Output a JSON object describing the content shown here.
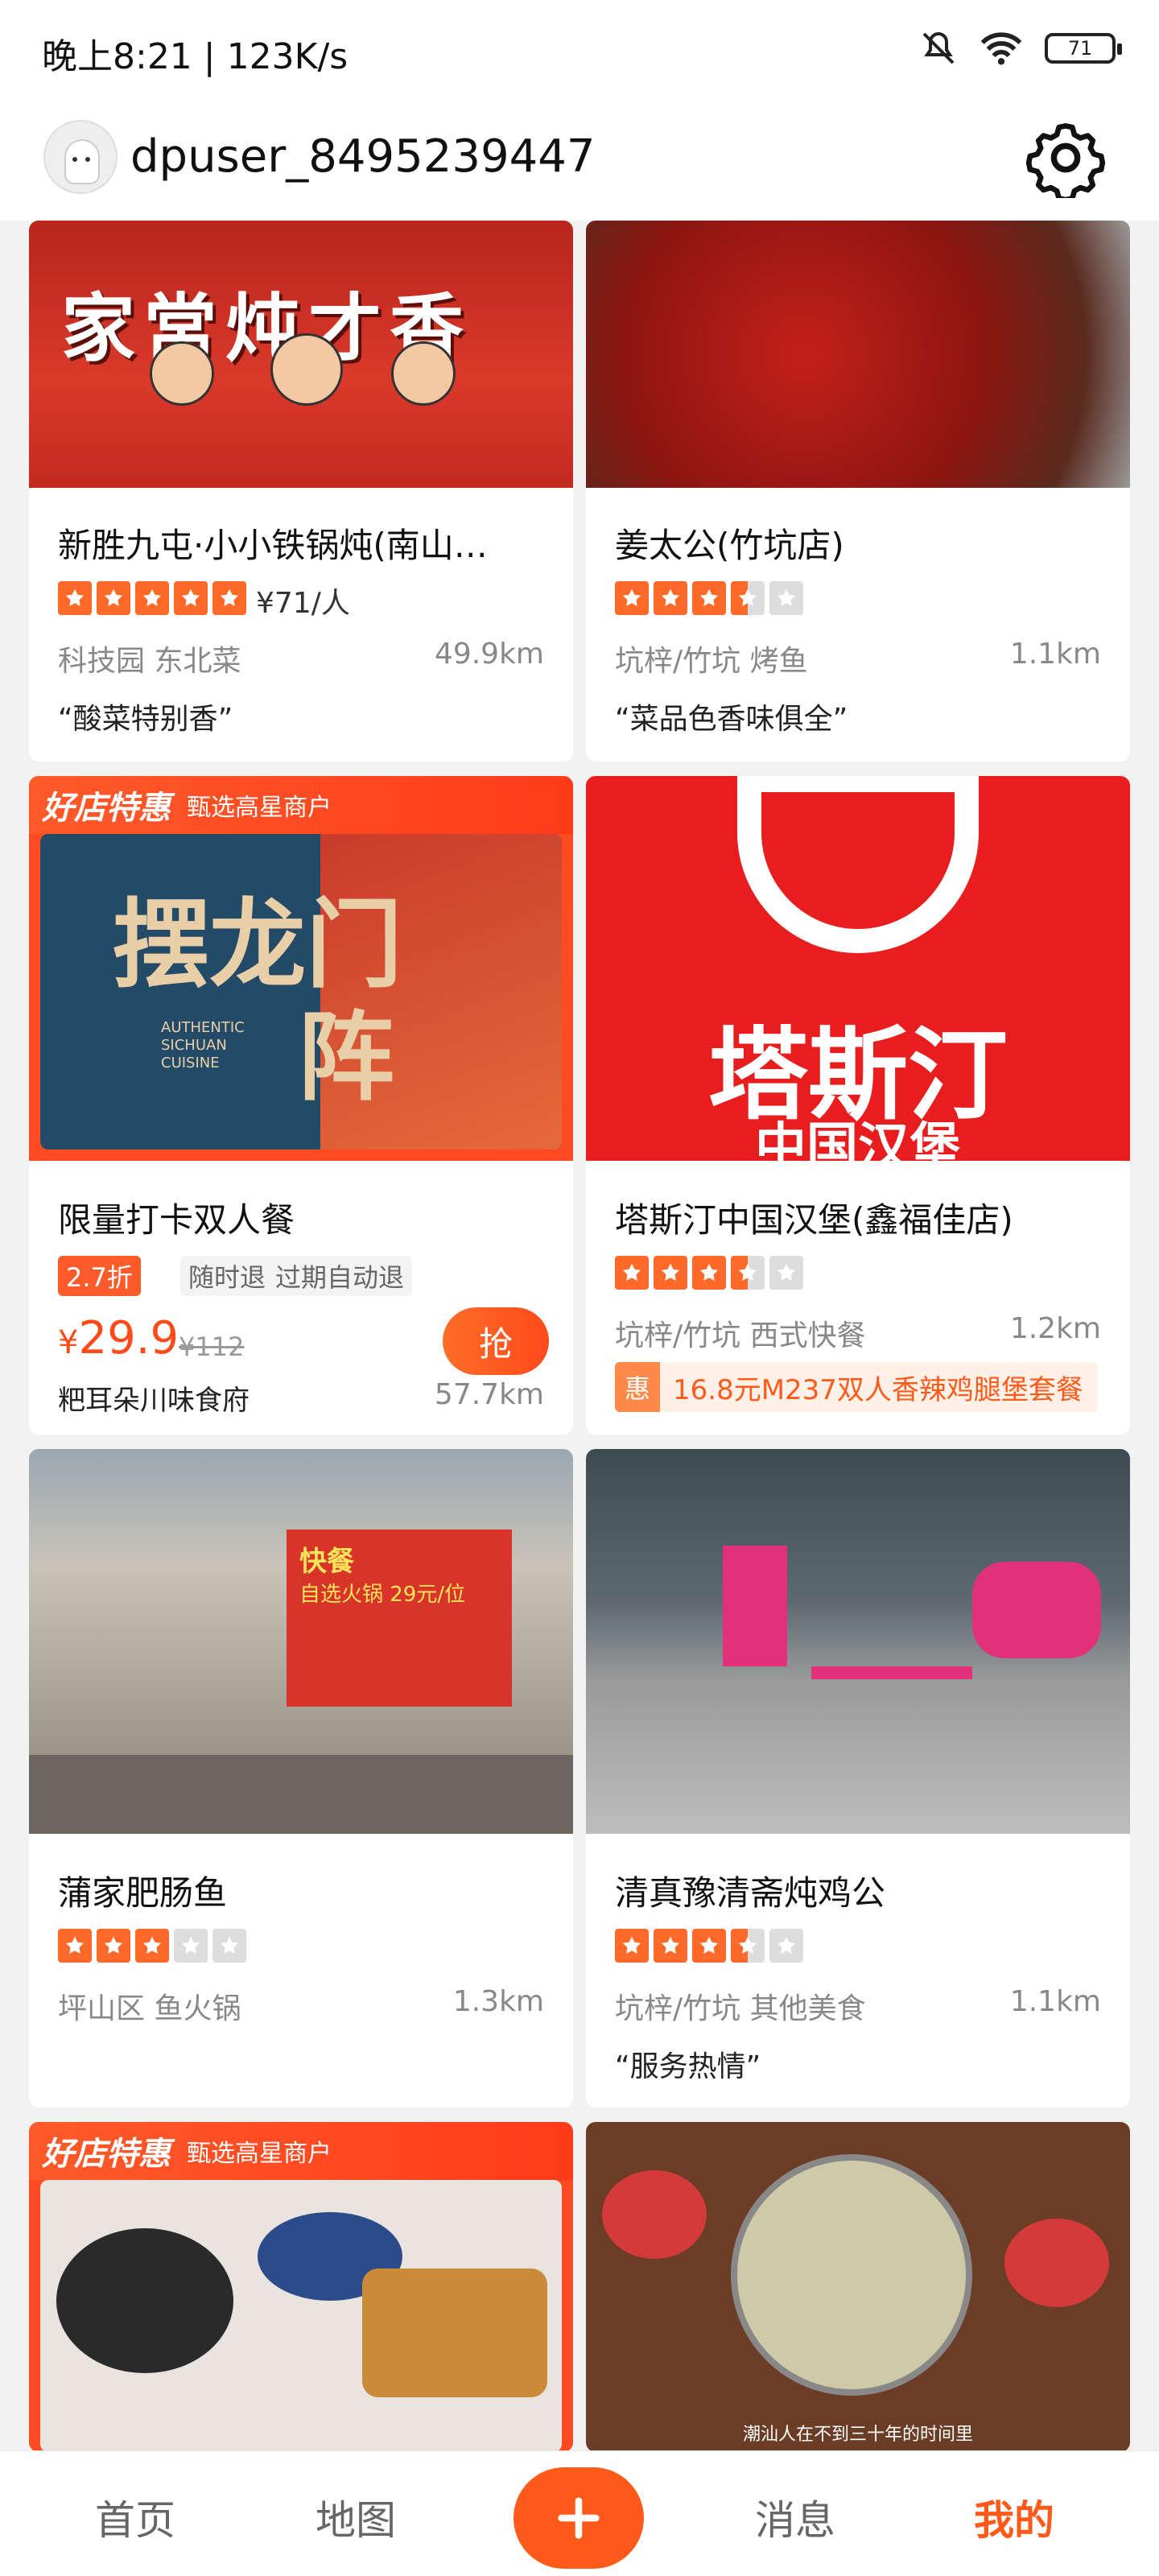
{
  "status_bar": {
    "time": "晚上8:21 | 123K/s",
    "battery": "71",
    "icons": [
      "mute-icon",
      "wifi-icon",
      "battery-icon"
    ]
  },
  "header": {
    "username": "dpuser_8495239447",
    "settings_icon": "gear-icon"
  },
  "cards": [
    {
      "title": "新胜九屯·小小铁锅炖(南山…",
      "price_per": "¥71/人",
      "rating": 5,
      "area": "科技园 东北菜",
      "distance": "49.9km",
      "quote": "“酸菜特别香”"
    },
    {
      "title": "姜太公(竹坑店)",
      "rating": 3.5,
      "area": "坑梓/竹坑 烤鱼",
      "distance": "1.1km",
      "quote": "“菜品色香味俱全”"
    },
    {
      "badge": "好店特惠",
      "badge_sub": "甄选高星商户",
      "title": "限量打卡双人餐",
      "discount": "2.7折",
      "tag1": "随时退",
      "tag2": "过期自动退",
      "price_symbol": "¥",
      "price": "29.9",
      "original_price": "¥112",
      "grab": "抢",
      "shop": "粑耳朵川味食府",
      "distance": "57.7km",
      "image_text_1": "摆龙门",
      "image_text_2": "阵",
      "image_sub": "AUTHENTIC SICHUAN CUISINE"
    },
    {
      "title": "塔斯汀中国汉堡(鑫福佳店)",
      "rating": 3.5,
      "area": "坑梓/竹坑 西式快餐",
      "distance": "1.2km",
      "promo_icon": "惠",
      "promo": "16.8元M237双人香辣鸡腿堡套餐",
      "image_text_1": "塔斯汀",
      "image_text_2": "中国汉堡"
    },
    {
      "title": "蒲家肥肠鱼",
      "rating": 3,
      "area": "坪山区 鱼火锅",
      "distance": "1.3km",
      "image_text_1": "快餐",
      "image_text_2": "自选火锅 29元/位"
    },
    {
      "title": "清真豫清斋炖鸡公",
      "rating": 3.5,
      "area": "坑梓/竹坑 其他美食",
      "distance": "1.1km",
      "quote": "“服务热情”"
    },
    {
      "badge": "好店特惠",
      "badge_sub": "甄选高星商户"
    },
    {
      "image_text_1": "潮汕人在不到三十年的时间里"
    }
  ],
  "image_texts": {
    "top_left": "家常炖才香"
  },
  "tabbar": {
    "home": "首页",
    "map": "地图",
    "messages": "消息",
    "mine": "我的"
  },
  "colors": {
    "accent": "#ff5a1a",
    "star": "#ff6a2a"
  }
}
